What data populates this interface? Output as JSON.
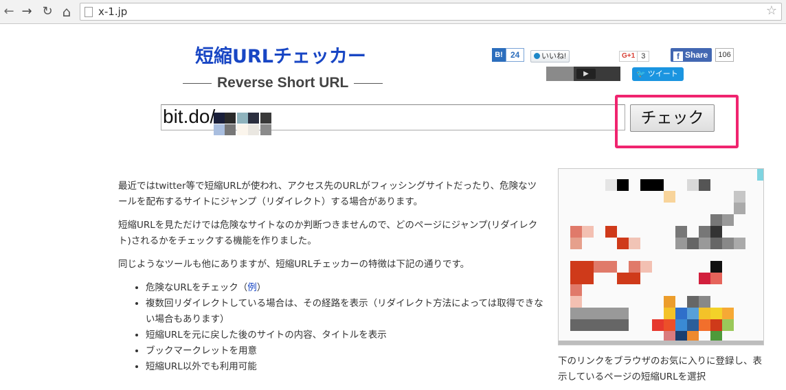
{
  "browser": {
    "url": "x-1.jp",
    "back_glyph": "←",
    "forward_glyph": "→",
    "reload_glyph": "↻",
    "home_glyph": "⌂",
    "star_glyph": "☆"
  },
  "header": {
    "title": "短縮URLチェッカー",
    "subtitle": "Reverse Short URL"
  },
  "social": {
    "hatena_logo": "B!",
    "hatena_count": "24",
    "mixi_label": "いいね!",
    "gplus_logo": "G+1",
    "gplus_count": "3",
    "fb_logo": "f",
    "fb_label": "Share",
    "fb_count": "106",
    "tweet_label": "ツイート",
    "colors": {
      "hatena": "#2c6ebd",
      "facebook": "#4267b2",
      "twitter": "#1b95e0"
    }
  },
  "search": {
    "value": "bit.do/",
    "button_label": "チェック",
    "highlight_color": "#f0246f"
  },
  "content": {
    "para1": "最近ではtwitter等で短縮URLが使われ、アクセス先のURLがフィッシングサイトだったり、危険なツールを配布するサイトにジャンプ（リダイレクト）する場合があります。",
    "para2": "短縮URLを見ただけでは危険なサイトなのか判断つきませんので、どのページにジャンプ(リダイレクト)されるかをチェックする機能を作りました。",
    "para3": "同じようなツールも他にありますが、短縮URLチェッカーの特徴は下記の通りです。",
    "feature1_text": "危険なURLをチェック（",
    "feature1_link": "例",
    "feature1_close": "）",
    "feature2": "複数回リダイレクトしている場合は、その経路を表示（リダイレクト方法によっては取得できない場合もあります）",
    "feature3": "短縮URLを元に戻した後のサイトの内容、タイトルを表示",
    "feature4": "ブックマークレットを用意",
    "feature5": "短縮URL以外でも利用可能"
  },
  "sidebar": {
    "text": "下のリンクをブラウザのお気に入りに登録し、表示しているページの短縮URLを選択"
  }
}
